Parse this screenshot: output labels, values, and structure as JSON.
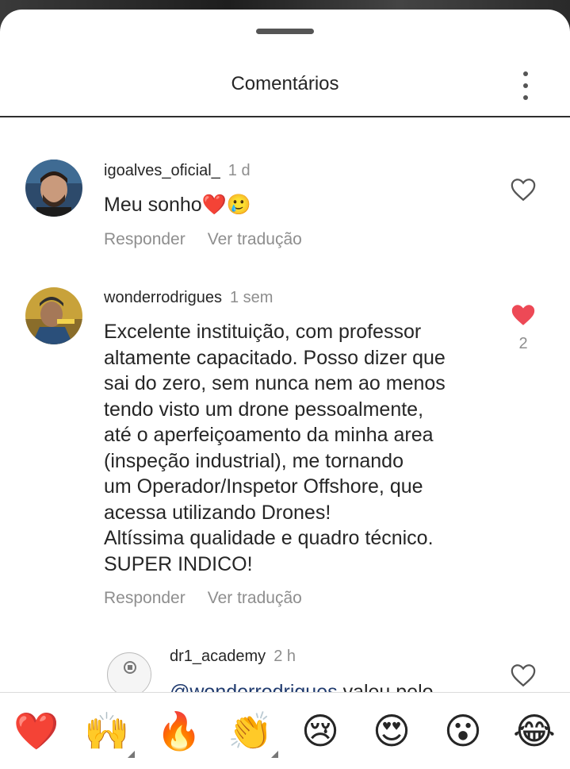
{
  "header": {
    "title": "Comentários"
  },
  "comments": [
    {
      "username": "igoalves_oficial_",
      "time": "1 d",
      "text": "Meu sonho❤️🥲",
      "reply_label": "Responder",
      "translate_label": "Ver tradução",
      "liked": false
    },
    {
      "username": "wonderrodrigues",
      "time": "1 sem",
      "lines": [
        "Excelente instituição, com professor",
        "altamente capacitado. Posso dizer que",
        "sai do zero, sem nunca nem ao menos",
        "tendo visto um drone pessoalmente,",
        "até o aperfeiçoamento da minha area",
        "(inspeção industrial), me tornando",
        "um Operador/Inspetor Offshore, que",
        "acessa utilizando Drones!",
        "Altíssima qualidade e quadro técnico.",
        "SUPER INDICO!"
      ],
      "reply_label": "Responder",
      "translate_label": "Ver tradução",
      "liked": true,
      "like_count": "2"
    },
    {
      "username": "dr1_academy",
      "time": "2 h",
      "avatar_text": "DR1 ACADEMY",
      "mention": "@wonderrodrigues",
      "text": "valeu pelo",
      "liked": false
    }
  ],
  "reactions": [
    {
      "emoji": "❤️",
      "name": "heart"
    },
    {
      "emoji": "🙌",
      "name": "raising-hands"
    },
    {
      "emoji": "🔥",
      "name": "fire"
    },
    {
      "emoji": "👏",
      "name": "clapping"
    },
    {
      "emoji": "😢",
      "name": "crying"
    },
    {
      "emoji": "😍",
      "name": "heart-eyes"
    },
    {
      "emoji": "😮",
      "name": "surprised"
    },
    {
      "emoji": "😂",
      "name": "tears-of-joy"
    }
  ],
  "colors": {
    "like_active": "#ed4956",
    "meta_text": "#8e8e8e",
    "primary_text": "#262626"
  }
}
